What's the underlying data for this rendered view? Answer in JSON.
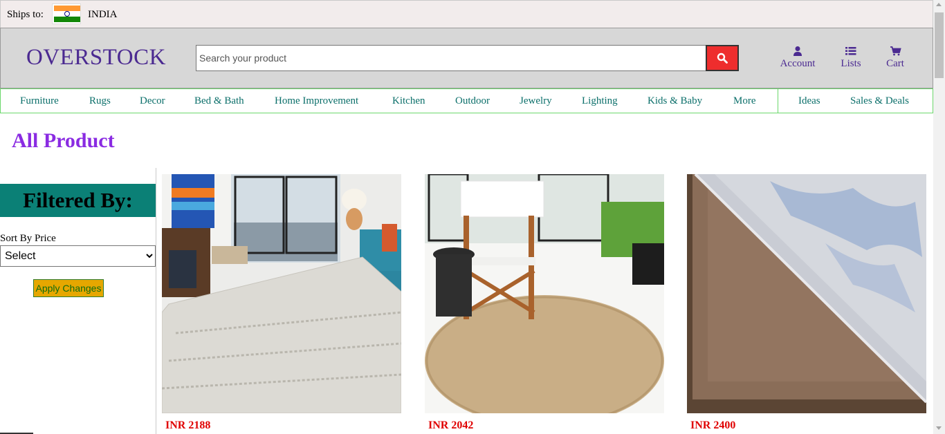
{
  "ships": {
    "label": "Ships to:",
    "country": "INDIA",
    "flag_icon": "india-flag-icon"
  },
  "header": {
    "logo": "OVERSTOCK",
    "search_placeholder": "Search your product",
    "search_icon": "search-icon",
    "account_label": "Account",
    "lists_label": "Lists",
    "cart_label": "Cart"
  },
  "nav": {
    "items": [
      "Furniture",
      "Rugs",
      "Decor",
      "Bed & Bath",
      "Home Improvement",
      "Kitchen",
      "Outdoor",
      "Jewelry",
      "Lighting",
      "Kids & Baby",
      "More"
    ],
    "extra": [
      "Ideas",
      "Sales & Deals"
    ]
  },
  "page_title": "All Product",
  "sidebar": {
    "filter_heading": "Filtered By:",
    "sort_label": "Sort By Price",
    "sort_selected": "Select",
    "apply_label": "Apply Changes"
  },
  "products": [
    {
      "price": "INR 2188"
    },
    {
      "price": "INR 2042"
    },
    {
      "price": "INR 2400"
    }
  ],
  "colors": {
    "logo": "#4b2a91",
    "nav_text": "#0b6f6a",
    "title": "#8a2be2",
    "filter_bg": "#0b8076",
    "price": "#e00000",
    "search_button": "#ee2d2d",
    "apply_button": "#e6a700"
  }
}
